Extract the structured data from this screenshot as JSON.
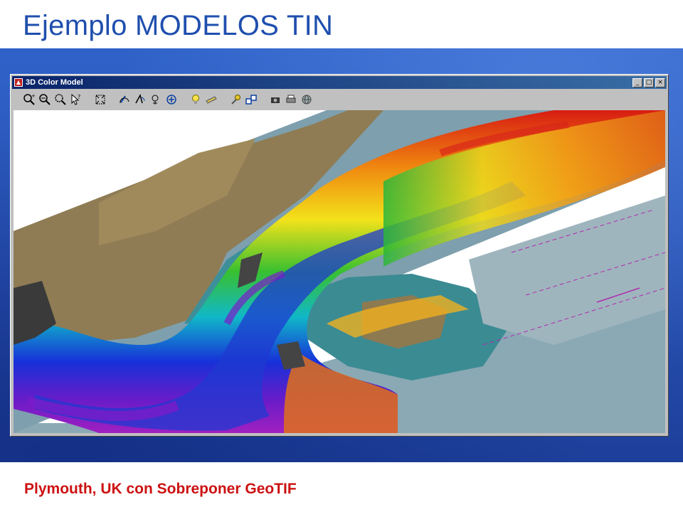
{
  "slide": {
    "title": "Ejemplo MODELOS TIN",
    "caption": "Plymouth, UK con Sobreponer GeoTIF"
  },
  "window": {
    "title": "3D Color Model",
    "controls": {
      "minimize": "_",
      "maximize": "□",
      "close": "×"
    }
  },
  "toolbar": {
    "tools": [
      "zoom-in-icon",
      "zoom-out-icon",
      "zoom-region-icon",
      "pointer-help-icon",
      "zoom-extents-icon",
      "rotate-icon",
      "tilt-icon",
      "pan-icon",
      "center-icon",
      "bulb-icon",
      "palette-icon",
      "settings-icon",
      "layers-icon",
      "camera-icon",
      "print-icon",
      "globe-icon"
    ]
  },
  "colors": {
    "title": "#1f4fae",
    "caption": "#cc1111",
    "band": "#2a55b8",
    "titlebar": "#0a246a",
    "chart_water": "#7fa3b3",
    "land": "#8b7a55"
  }
}
